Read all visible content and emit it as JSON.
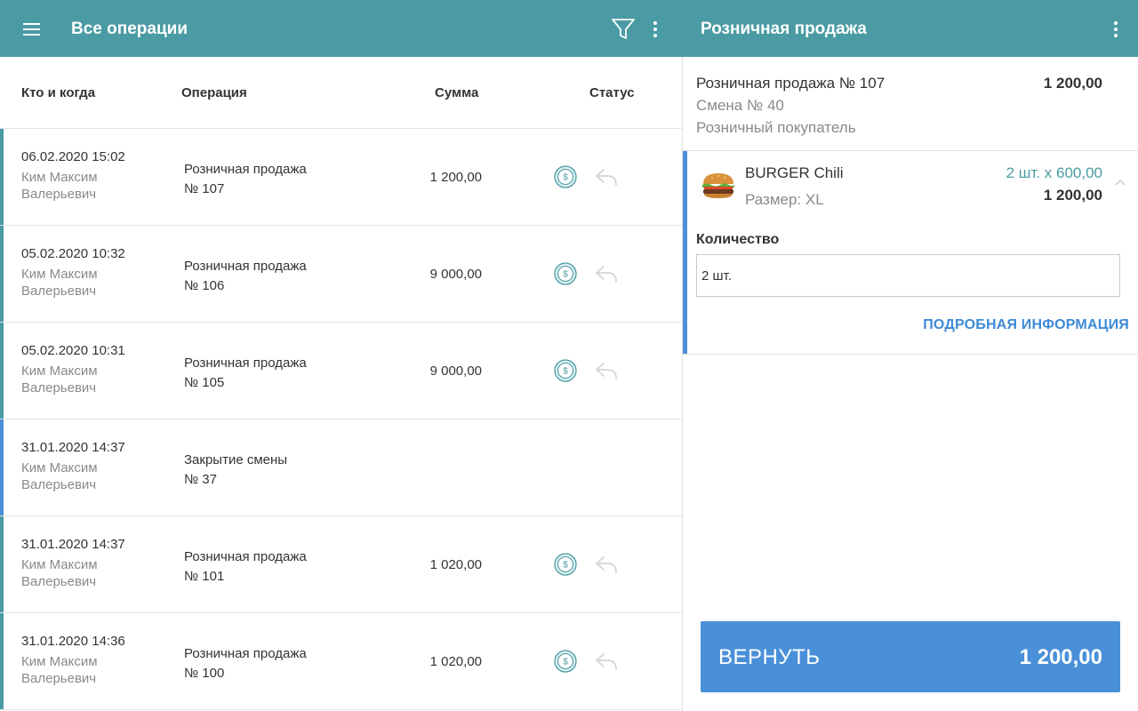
{
  "left_header": {
    "title": "Все операции",
    "menu_icon": "hamburger-menu-icon",
    "filter_icon": "filter-funnel-icon",
    "more_icon": "more-vertical-icon"
  },
  "table": {
    "columns": [
      "Кто и когда",
      "Операция",
      "Сумма",
      "Статус"
    ],
    "rows": [
      {
        "date": "06.02.2020 15:02",
        "who": "Ким Максим Валерьевич",
        "op_title": "Розничная продажа",
        "op_number": "№ 107",
        "sum": "1 200,00",
        "has_status": true,
        "accent": "teal"
      },
      {
        "date": "05.02.2020 10:32",
        "who": "Ким Максим Валерьевич",
        "op_title": "Розничная продажа",
        "op_number": "№ 106",
        "sum": "9 000,00",
        "has_status": true,
        "accent": "teal"
      },
      {
        "date": "05.02.2020 10:31",
        "who": "Ким Максим Валерьевич",
        "op_title": "Розничная продажа",
        "op_number": "№ 105",
        "sum": "9 000,00",
        "has_status": true,
        "accent": "teal"
      },
      {
        "date": "31.01.2020 14:37",
        "who": "Ким Максим Валерьевич",
        "op_title": "Закрытие смены",
        "op_number": "№ 37",
        "sum": "",
        "has_status": false,
        "accent": "blue"
      },
      {
        "date": "31.01.2020 14:37",
        "who": "Ким Максим Валерьевич",
        "op_title": "Розничная продажа",
        "op_number": "№ 101",
        "sum": "1 020,00",
        "has_status": true,
        "accent": "teal"
      },
      {
        "date": "31.01.2020 14:36",
        "who": "Ким Максим Валерьевич",
        "op_title": "Розничная продажа",
        "op_number": "№ 100",
        "sum": "1 020,00",
        "has_status": true,
        "accent": "teal"
      }
    ],
    "status_icons": [
      "cash-coin-icon",
      "return-reply-icon"
    ]
  },
  "right_header": {
    "title": "Розничная продажа",
    "more_icon": "more-vertical-icon"
  },
  "detail": {
    "title": "Розничная продажа № 107",
    "total": "1 200,00",
    "shift": "Смена № 40",
    "buyer": "Розничный покупатель",
    "item": {
      "name": "BURGER Chili",
      "size": "Размер: XL",
      "qty_price": "2 шт. x 600,00",
      "total": "1 200,00",
      "image_icon": "burger-image-icon",
      "collapse_icon": "chevron-up-icon"
    },
    "quantity_label": "Количество",
    "quantity_value": "2 шт.",
    "more_info": "ПОДРОБНАЯ ИНФОРМАЦИЯ"
  },
  "return_button": {
    "label": "ВЕРНУТЬ",
    "sum": "1 200,00"
  },
  "colors": {
    "header": "#4a9ba3",
    "accent_blue": "#4a90d9",
    "link": "#3d8ad6"
  }
}
